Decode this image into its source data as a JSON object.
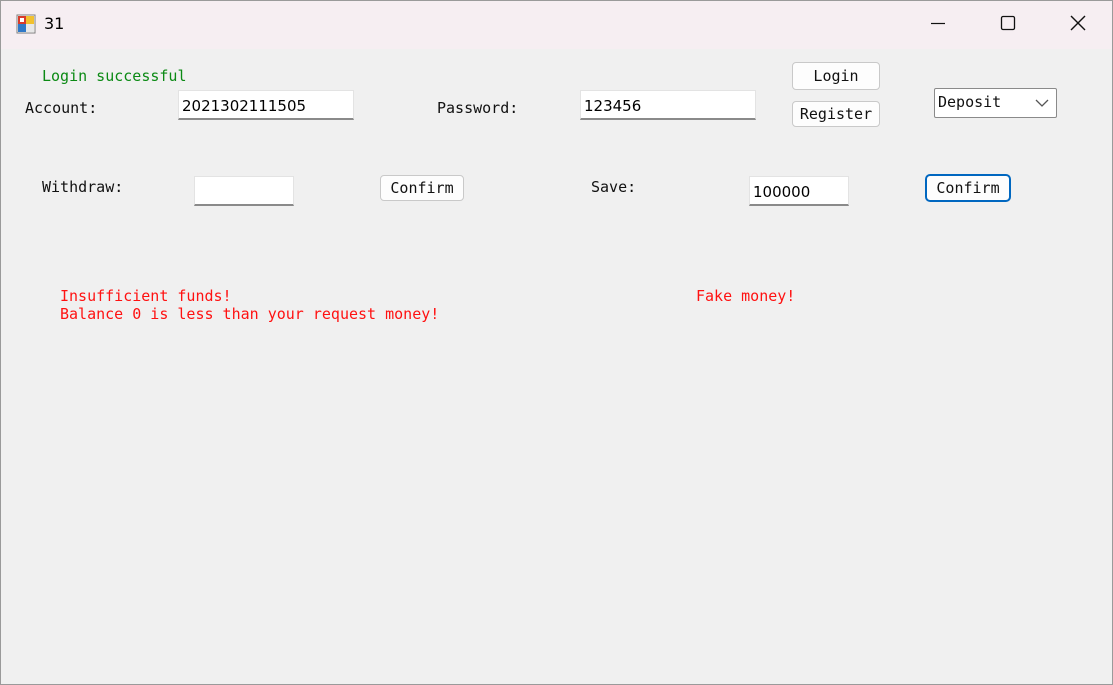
{
  "window": {
    "title": "31",
    "icon": "windows-forms-app-icon",
    "controls": {
      "minimize": "minimize-icon",
      "maximize": "maximize-icon",
      "close": "close-icon"
    }
  },
  "form": {
    "login_status": "Login successful",
    "account_label": "Account:",
    "account_value": "2021302111505",
    "password_label": "Password:",
    "password_value": "123456",
    "login_button": "Login",
    "register_button": "Register",
    "mode_select": {
      "selected": "Deposit"
    },
    "withdraw_label": "Withdraw:",
    "withdraw_value": "",
    "withdraw_confirm": "Confirm",
    "save_label": "Save:",
    "save_value": "100000",
    "save_confirm": "Confirm",
    "withdraw_error_line1": "Insufficient funds!",
    "withdraw_error_line2": "Balance 0 is less than your request money!",
    "save_error": "Fake money!"
  },
  "colors": {
    "success": "#0b8a14",
    "error": "#ff1111",
    "focus": "#0067c0"
  }
}
